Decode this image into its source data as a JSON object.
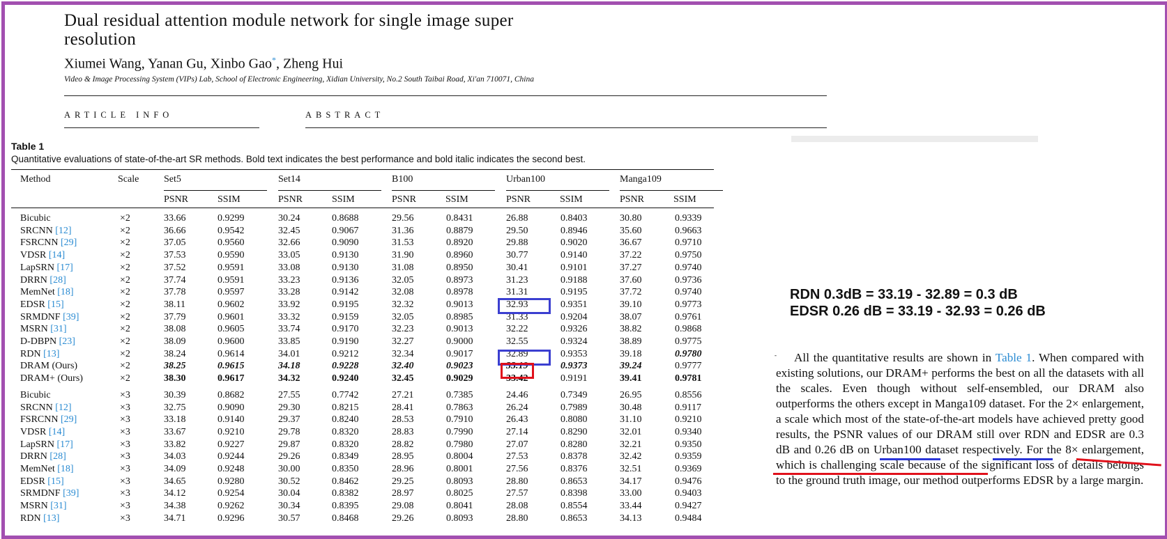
{
  "paper": {
    "title_line1": "Dual residual attention module network for single image super",
    "title_line2": "resolution",
    "authors": "Xiumei Wang, Yanan Gu, Xinbo Gao",
    "authors_mark": "*",
    "authors_tail": ", Zheng Hui",
    "affiliation": "Video & Image Processing System (VIPs) Lab, School of Electronic Engineering, Xidian University, No.2 South Taibai Road, Xi'an 710071, China",
    "article_info": "ARTICLE INFO",
    "abstract": "ABSTRACT"
  },
  "table": {
    "caption": "Table 1",
    "description": "Quantitative evaluations of state-of-the-art SR methods. Bold text indicates the best performance and bold italic indicates the second best.",
    "col_method": "Method",
    "col_scale": "Scale",
    "datasets": [
      "Set5",
      "Set14",
      "B100",
      "Urban100",
      "Manga109"
    ],
    "metric_psnr": "PSNR",
    "metric_ssim": "SSIM",
    "rows": [
      {
        "m": "Bicubic",
        "r": "",
        "s": "×2",
        "v": [
          "33.66",
          "0.9299",
          "30.24",
          "0.8688",
          "29.56",
          "0.8431",
          "26.88",
          "0.8403",
          "30.80",
          "0.9339"
        ],
        "f": [
          "",
          "",
          "",
          "",
          "",
          "",
          "",
          "",
          "",
          ""
        ]
      },
      {
        "m": "SRCNN ",
        "r": "[12]",
        "s": "×2",
        "v": [
          "36.66",
          "0.9542",
          "32.45",
          "0.9067",
          "31.36",
          "0.8879",
          "29.50",
          "0.8946",
          "35.60",
          "0.9663"
        ],
        "f": [
          "",
          "",
          "",
          "",
          "",
          "",
          "",
          "",
          "",
          ""
        ]
      },
      {
        "m": "FSRCNN ",
        "r": "[29]",
        "s": "×2",
        "v": [
          "37.05",
          "0.9560",
          "32.66",
          "0.9090",
          "31.53",
          "0.8920",
          "29.88",
          "0.9020",
          "36.67",
          "0.9710"
        ],
        "f": [
          "",
          "",
          "",
          "",
          "",
          "",
          "",
          "",
          "",
          ""
        ]
      },
      {
        "m": "VDSR ",
        "r": "[14]",
        "s": "×2",
        "v": [
          "37.53",
          "0.9590",
          "33.05",
          "0.9130",
          "31.90",
          "0.8960",
          "30.77",
          "0.9140",
          "37.22",
          "0.9750"
        ],
        "f": [
          "",
          "",
          "",
          "",
          "",
          "",
          "",
          "",
          "",
          ""
        ]
      },
      {
        "m": "LapSRN ",
        "r": "[17]",
        "s": "×2",
        "v": [
          "37.52",
          "0.9591",
          "33.08",
          "0.9130",
          "31.08",
          "0.8950",
          "30.41",
          "0.9101",
          "37.27",
          "0.9740"
        ],
        "f": [
          "",
          "",
          "",
          "",
          "",
          "",
          "",
          "",
          "",
          ""
        ]
      },
      {
        "m": "DRRN ",
        "r": "[28]",
        "s": "×2",
        "v": [
          "37.74",
          "0.9591",
          "33.23",
          "0.9136",
          "32.05",
          "0.8973",
          "31.23",
          "0.9188",
          "37.60",
          "0.9736"
        ],
        "f": [
          "",
          "",
          "",
          "",
          "",
          "",
          "",
          "",
          "",
          ""
        ]
      },
      {
        "m": "MemNet ",
        "r": "[18]",
        "s": "×2",
        "v": [
          "37.78",
          "0.9597",
          "33.28",
          "0.9142",
          "32.08",
          "0.8978",
          "31.31",
          "0.9195",
          "37.72",
          "0.9740"
        ],
        "f": [
          "",
          "",
          "",
          "",
          "",
          "",
          "",
          "",
          "",
          ""
        ]
      },
      {
        "m": "EDSR ",
        "r": "[15]",
        "s": "×2",
        "v": [
          "38.11",
          "0.9602",
          "33.92",
          "0.9195",
          "32.32",
          "0.9013",
          "32.93",
          "0.9351",
          "39.10",
          "0.9773"
        ],
        "f": [
          "",
          "",
          "",
          "",
          "",
          "",
          "",
          "",
          "",
          ""
        ]
      },
      {
        "m": "SRMDNF ",
        "r": "[39]",
        "s": "×2",
        "v": [
          "37.79",
          "0.9601",
          "33.32",
          "0.9159",
          "32.05",
          "0.8985",
          "31.33",
          "0.9204",
          "38.07",
          "0.9761"
        ],
        "f": [
          "",
          "",
          "",
          "",
          "",
          "",
          "",
          "",
          "",
          ""
        ]
      },
      {
        "m": "MSRN ",
        "r": "[31]",
        "s": "×2",
        "v": [
          "38.08",
          "0.9605",
          "33.74",
          "0.9170",
          "32.23",
          "0.9013",
          "32.22",
          "0.9326",
          "38.82",
          "0.9868"
        ],
        "f": [
          "",
          "",
          "",
          "",
          "",
          "",
          "",
          "",
          "",
          ""
        ]
      },
      {
        "m": "D-DBPN ",
        "r": "[23]",
        "s": "×2",
        "v": [
          "38.09",
          "0.9600",
          "33.85",
          "0.9190",
          "32.27",
          "0.9000",
          "32.55",
          "0.9324",
          "38.89",
          "0.9775"
        ],
        "f": [
          "",
          "",
          "",
          "",
          "",
          "",
          "",
          "",
          "",
          ""
        ]
      },
      {
        "m": "RDN ",
        "r": "[13]",
        "s": "×2",
        "v": [
          "38.24",
          "0.9614",
          "34.01",
          "0.9212",
          "32.34",
          "0.9017",
          "32.89",
          "0.9353",
          "39.18",
          "0.9780"
        ],
        "f": [
          "",
          "",
          "",
          "",
          "",
          "",
          "",
          "",
          "",
          "bi"
        ]
      },
      {
        "m": "DRAM (Ours)",
        "r": "",
        "s": "×2",
        "v": [
          "38.25",
          "0.9615",
          "34.18",
          "0.9228",
          "32.40",
          "0.9023",
          "33.19",
          "0.9373",
          "39.24",
          "0.9777"
        ],
        "f": [
          "bi",
          "bi",
          "bi",
          "bi",
          "bi",
          "bi",
          "bi",
          "bi",
          "bi",
          ""
        ]
      },
      {
        "m": "DRAM+ (Ours)",
        "r": "",
        "s": "×2",
        "v": [
          "38.30",
          "0.9617",
          "34.32",
          "0.9240",
          "32.45",
          "0.9029",
          "33.42",
          "0.9191",
          "39.41",
          "0.9781"
        ],
        "f": [
          "b",
          "b",
          "b",
          "b",
          "b",
          "b",
          "b",
          "",
          "b",
          "b"
        ]
      },
      {
        "m": "Bicubic",
        "r": "",
        "s": "×3",
        "v": [
          "30.39",
          "0.8682",
          "27.55",
          "0.7742",
          "27.21",
          "0.7385",
          "24.46",
          "0.7349",
          "26.95",
          "0.8556"
        ],
        "f": [
          "",
          "",
          "",
          "",
          "",
          "",
          "",
          "",
          "",
          ""
        ]
      },
      {
        "m": "SRCNN ",
        "r": "[12]",
        "s": "×3",
        "v": [
          "32.75",
          "0.9090",
          "29.30",
          "0.8215",
          "28.41",
          "0.7863",
          "26.24",
          "0.7989",
          "30.48",
          "0.9117"
        ],
        "f": [
          "",
          "",
          "",
          "",
          "",
          "",
          "",
          "",
          "",
          ""
        ]
      },
      {
        "m": "FSRCNN ",
        "r": "[29]",
        "s": "×3",
        "v": [
          "33.18",
          "0.9140",
          "29.37",
          "0.8240",
          "28.53",
          "0.7910",
          "26.43",
          "0.8080",
          "31.10",
          "0.9210"
        ],
        "f": [
          "",
          "",
          "",
          "",
          "",
          "",
          "",
          "",
          "",
          ""
        ]
      },
      {
        "m": "VDSR ",
        "r": "[14]",
        "s": "×3",
        "v": [
          "33.67",
          "0.9210",
          "29.78",
          "0.8320",
          "28.83",
          "0.7990",
          "27.14",
          "0.8290",
          "32.01",
          "0.9340"
        ],
        "f": [
          "",
          "",
          "",
          "",
          "",
          "",
          "",
          "",
          "",
          ""
        ]
      },
      {
        "m": "LapSRN ",
        "r": "[17]",
        "s": "×3",
        "v": [
          "33.82",
          "0.9227",
          "29.87",
          "0.8320",
          "28.82",
          "0.7980",
          "27.07",
          "0.8280",
          "32.21",
          "0.9350"
        ],
        "f": [
          "",
          "",
          "",
          "",
          "",
          "",
          "",
          "",
          "",
          ""
        ]
      },
      {
        "m": "DRRN ",
        "r": "[28]",
        "s": "×3",
        "v": [
          "34.03",
          "0.9244",
          "29.26",
          "0.8349",
          "28.95",
          "0.8004",
          "27.53",
          "0.8378",
          "32.42",
          "0.9359"
        ],
        "f": [
          "",
          "",
          "",
          "",
          "",
          "",
          "",
          "",
          "",
          ""
        ]
      },
      {
        "m": "MemNet ",
        "r": "[18]",
        "s": "×3",
        "v": [
          "34.09",
          "0.9248",
          "30.00",
          "0.8350",
          "28.96",
          "0.8001",
          "27.56",
          "0.8376",
          "32.51",
          "0.9369"
        ],
        "f": [
          "",
          "",
          "",
          "",
          "",
          "",
          "",
          "",
          "",
          ""
        ]
      },
      {
        "m": "EDSR ",
        "r": "[15]",
        "s": "×3",
        "v": [
          "34.65",
          "0.9280",
          "30.52",
          "0.8462",
          "29.25",
          "0.8093",
          "28.80",
          "0.8653",
          "34.17",
          "0.9476"
        ],
        "f": [
          "",
          "",
          "",
          "",
          "",
          "",
          "",
          "",
          "",
          ""
        ]
      },
      {
        "m": "SRMDNF ",
        "r": "[39]",
        "s": "×3",
        "v": [
          "34.12",
          "0.9254",
          "30.04",
          "0.8382",
          "28.97",
          "0.8025",
          "27.57",
          "0.8398",
          "33.00",
          "0.9403"
        ],
        "f": [
          "",
          "",
          "",
          "",
          "",
          "",
          "",
          "",
          "",
          ""
        ]
      },
      {
        "m": "MSRN ",
        "r": "[31]",
        "s": "×3",
        "v": [
          "34.38",
          "0.9262",
          "30.34",
          "0.8395",
          "29.08",
          "0.8041",
          "28.08",
          "0.8554",
          "33.44",
          "0.9427"
        ],
        "f": [
          "",
          "",
          "",
          "",
          "",
          "",
          "",
          "",
          "",
          ""
        ]
      },
      {
        "m": "RDN ",
        "r": "[13]",
        "s": "×3",
        "v": [
          "34.71",
          "0.9296",
          "30.57",
          "0.8468",
          "29.26",
          "0.8093",
          "28.80",
          "0.8653",
          "34.13",
          "0.9484"
        ],
        "f": [
          "",
          "",
          "",
          "",
          "",
          "",
          "",
          "",
          "",
          ""
        ]
      }
    ]
  },
  "annotations": {
    "calc1": "RDN 0.3dB = 33.19 - 32.89 = 0.3 dB",
    "calc2": "EDSR 0.26 dB = 33.19 - 32.93 = 0.26 dB",
    "box_color_blue": "#3b3fd0",
    "box_color_red": "#e0111b",
    "underline_blue": "#2a35d8",
    "underline_red": "#e0111b"
  },
  "paragraph": {
    "mark": "-",
    "p1": "All the quantitative results are shown in ",
    "tref": "Table 1",
    "p2": ". When compared with existing solutions, our DRAM+ performs the best on all the datasets with all the scales. Even though without self-ensembled, our DRAM also outperforms the others except in Manga109 dataset. For the 2× enlargement, a scale which most of the state-of-the-art models have achieved pretty good results, the PSNR values of our DRAM still over RDN and EDSR are 0.3 dB and 0.26 dB on Urban100 dataset respectively. For the 8× enlargement, which is challenging scale because of the significant loss of details belongs to the ground truth image, our method outperforms EDSR by a large margin."
  }
}
